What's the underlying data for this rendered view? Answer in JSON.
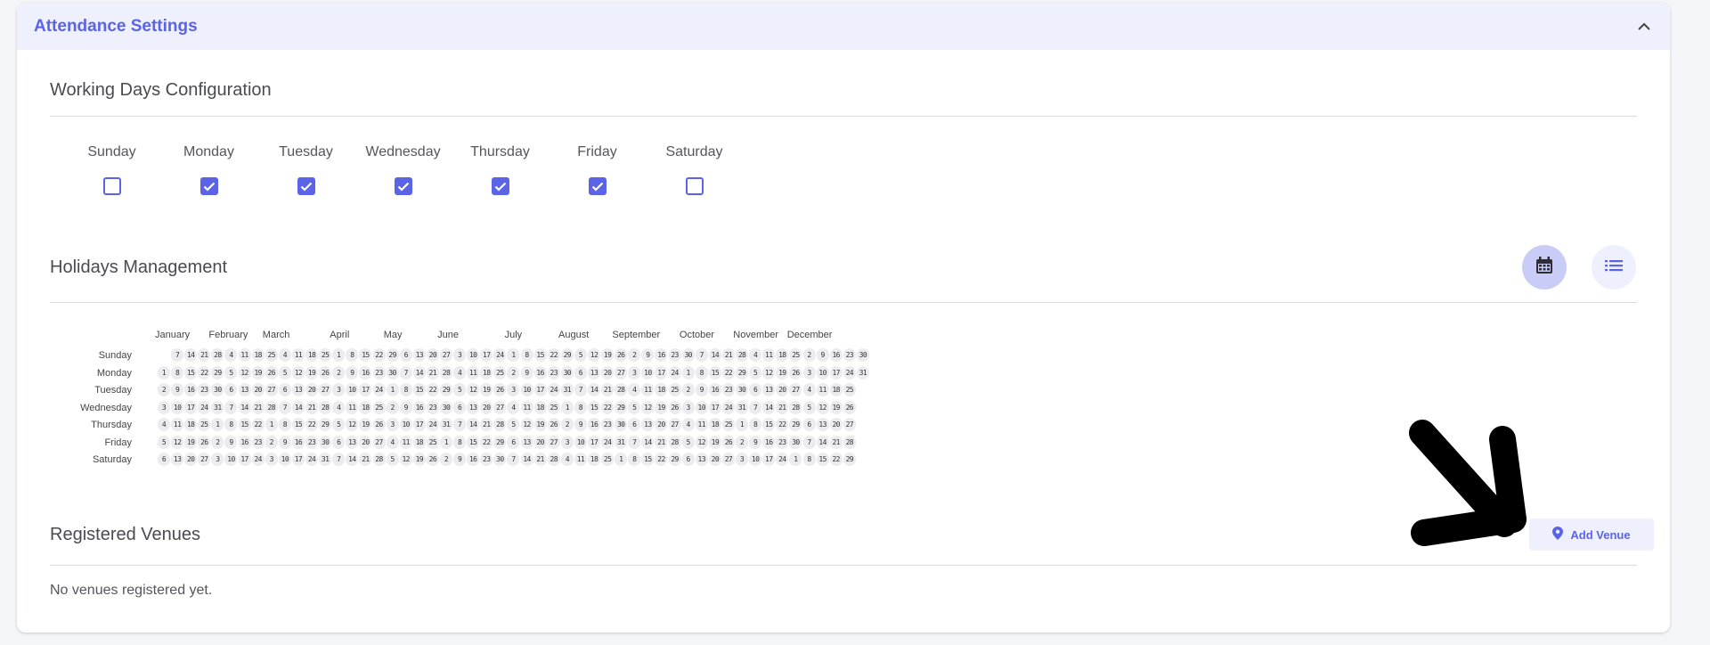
{
  "header": {
    "title": "Attendance Settings"
  },
  "working_days": {
    "title": "Working Days Configuration",
    "days": [
      {
        "label": "Sunday",
        "checked": false
      },
      {
        "label": "Monday",
        "checked": true
      },
      {
        "label": "Tuesday",
        "checked": true
      },
      {
        "label": "Wednesday",
        "checked": true
      },
      {
        "label": "Thursday",
        "checked": true
      },
      {
        "label": "Friday",
        "checked": true
      },
      {
        "label": "Saturday",
        "checked": false
      }
    ]
  },
  "holidays": {
    "title": "Holidays Management",
    "active_view": "calendar",
    "months": [
      "January",
      "February",
      "March",
      "April",
      "May",
      "June",
      "July",
      "August",
      "September",
      "October",
      "November",
      "December"
    ],
    "weekdays": [
      "Sunday",
      "Monday",
      "Tuesday",
      "Wednesday",
      "Thursday",
      "Friday",
      "Saturday"
    ]
  },
  "venues": {
    "title": "Registered Venues",
    "add_button_label": "Add Venue",
    "empty_message": "No venues registered yet."
  },
  "colors": {
    "accent": "#5b63e6",
    "accent_light": "#eef0fd"
  }
}
